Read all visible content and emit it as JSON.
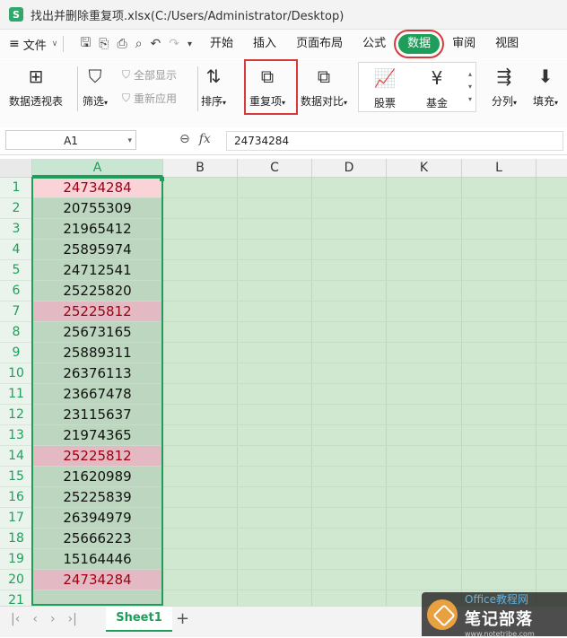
{
  "window": {
    "title": "找出并删除重复项.xlsx(C:/Users/Administrator/Desktop)",
    "logo_letter": "S"
  },
  "menu": {
    "file_label": "文件",
    "tabs": [
      "开始",
      "插入",
      "页面布局",
      "公式",
      "数据",
      "审阅",
      "视图"
    ],
    "active_tab": "数据"
  },
  "ribbon": {
    "pivot": "数据透视表",
    "filter": "筛选",
    "show_all": "全部显示",
    "reapply": "重新应用",
    "sort": "排序",
    "duplicates": "重复项",
    "compare": "数据对比",
    "stock": "股票",
    "fund": "基金",
    "split": "分列",
    "fill": "填充"
  },
  "formula_bar": {
    "name_box": "A1",
    "fx_label": "fx",
    "value": "24734284"
  },
  "columns": [
    "A",
    "B",
    "C",
    "D",
    "K",
    "L"
  ],
  "selected_column": "A",
  "rows": [
    {
      "n": "1",
      "v": "24734284",
      "dup": true
    },
    {
      "n": "2",
      "v": "20755309",
      "dup": false
    },
    {
      "n": "3",
      "v": "21965412",
      "dup": false
    },
    {
      "n": "4",
      "v": "25895974",
      "dup": false
    },
    {
      "n": "5",
      "v": "24712541",
      "dup": false
    },
    {
      "n": "6",
      "v": "25225820",
      "dup": false
    },
    {
      "n": "7",
      "v": "25225812",
      "dup": true
    },
    {
      "n": "8",
      "v": "25673165",
      "dup": false
    },
    {
      "n": "9",
      "v": "25889311",
      "dup": false
    },
    {
      "n": "10",
      "v": "26376113",
      "dup": false
    },
    {
      "n": "11",
      "v": "23667478",
      "dup": false
    },
    {
      "n": "12",
      "v": "23115637",
      "dup": false
    },
    {
      "n": "13",
      "v": "21974365",
      "dup": false
    },
    {
      "n": "14",
      "v": "25225812",
      "dup": true
    },
    {
      "n": "15",
      "v": "21620989",
      "dup": false
    },
    {
      "n": "16",
      "v": "25225839",
      "dup": false
    },
    {
      "n": "17",
      "v": "26394979",
      "dup": false
    },
    {
      "n": "18",
      "v": "25666223",
      "dup": false
    },
    {
      "n": "19",
      "v": "15164446",
      "dup": false
    },
    {
      "n": "20",
      "v": "24734284",
      "dup": true
    },
    {
      "n": "21",
      "v": "",
      "dup": false
    }
  ],
  "sheet_tab": "Sheet1",
  "watermark": {
    "top": "Office教程网",
    "main": "笔记部落",
    "url": "www.notetribe.com"
  },
  "colors": {
    "accent": "#1f9e5b",
    "highlight_box": "#d63a3a",
    "dup_fill": "#e3b9c3",
    "dup_text": "#9c0010"
  }
}
